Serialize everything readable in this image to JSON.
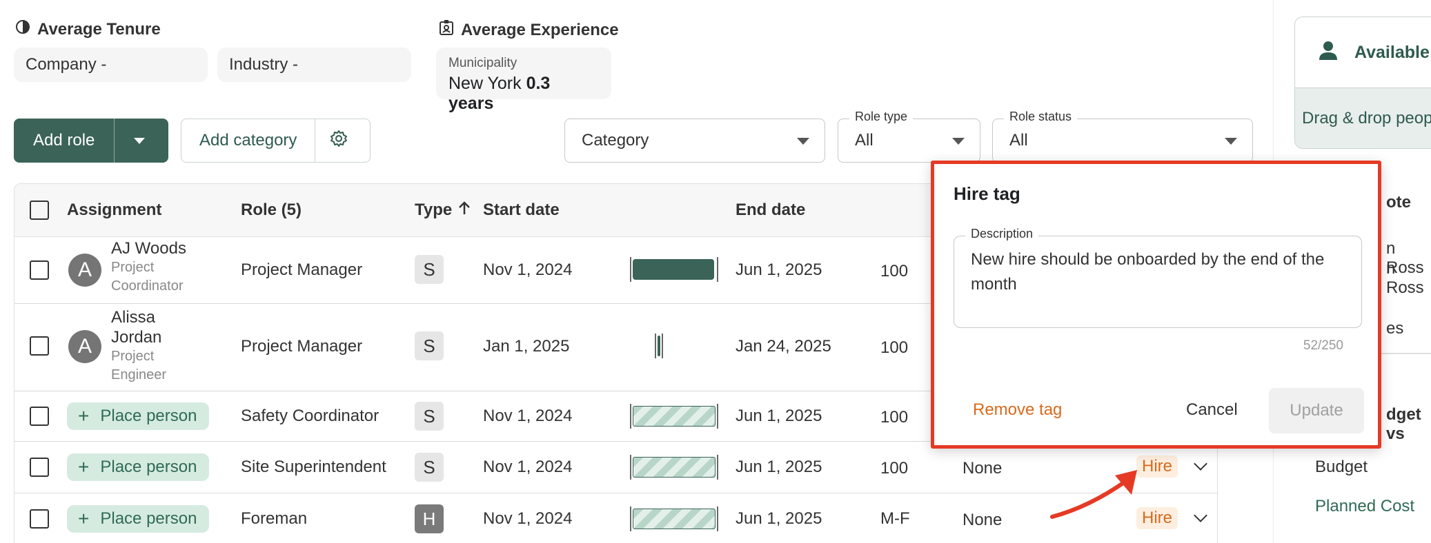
{
  "summary": {
    "tenure_title": "Average Tenure",
    "company": "Company -",
    "industry": "Industry -",
    "experience_title": "Average Experience",
    "municipality_label": "Municipality",
    "municipality_city": "New York",
    "municipality_years": "0.3 years"
  },
  "toolbar": {
    "add_role": "Add role",
    "add_category": "Add category",
    "category_placeholder": "Category",
    "role_type_label": "Role type",
    "role_type_value": "All",
    "role_status_label": "Role status",
    "role_status_value": "All"
  },
  "table": {
    "headers": {
      "assignment": "Assignment",
      "role": "Role (5)",
      "type": "Type",
      "start": "Start date",
      "end": "End date"
    },
    "rows": [
      {
        "avatar": "A",
        "name": "AJ Woods",
        "title_line1": "Project",
        "title_line2": "Coordinator",
        "role": "Project Manager",
        "type": "S",
        "start": "Nov 1, 2024",
        "end": "Jun 1, 2025",
        "alloc": "100"
      },
      {
        "avatar": "A",
        "name_line1": "Alissa",
        "name_line2": "Jordan",
        "title_line1": "Project",
        "title_line2": "Engineer",
        "role": "Project Manager",
        "type": "S",
        "start": "Jan 1, 2025",
        "end": "Jan 24, 2025",
        "alloc": "100"
      },
      {
        "place": "Place person",
        "role": "Safety Coordinator",
        "type": "S",
        "start": "Nov 1, 2024",
        "end": "Jun 1, 2025",
        "alloc": "100"
      },
      {
        "place": "Place person",
        "role": "Site Superintendent",
        "type": "S",
        "start": "Nov 1, 2024",
        "end": "Jun 1, 2025",
        "alloc": "100",
        "note": "None",
        "tag": "Hire"
      },
      {
        "place": "Place person",
        "role": "Foreman",
        "type": "H",
        "start": "Nov 1, 2024",
        "end": "Jun 1, 2025",
        "alloc": "M-F",
        "note": "None",
        "tag": "Hire"
      }
    ]
  },
  "right_panel": {
    "available": "Available",
    "drag_drop": "Drag & drop peop",
    "frag_ote": "ote",
    "frag_ross1": "n Ross",
    "frag_ross2": "n Ross",
    "frag_es": "es",
    "frag_budget_vs": "dget vs",
    "budget": "Budget",
    "planned_cost": "Planned Cost"
  },
  "dialog": {
    "title": "Hire tag",
    "description_label": "Description",
    "description": "New hire should be onboarded by the end of the month",
    "counter": "52/250",
    "remove": "Remove tag",
    "cancel": "Cancel",
    "update": "Update"
  },
  "colors": {
    "primary": "#3b6358",
    "accent_orange": "#d86a1c",
    "highlight_red": "#e53a25",
    "chip_bg": "#d6ebe0"
  }
}
